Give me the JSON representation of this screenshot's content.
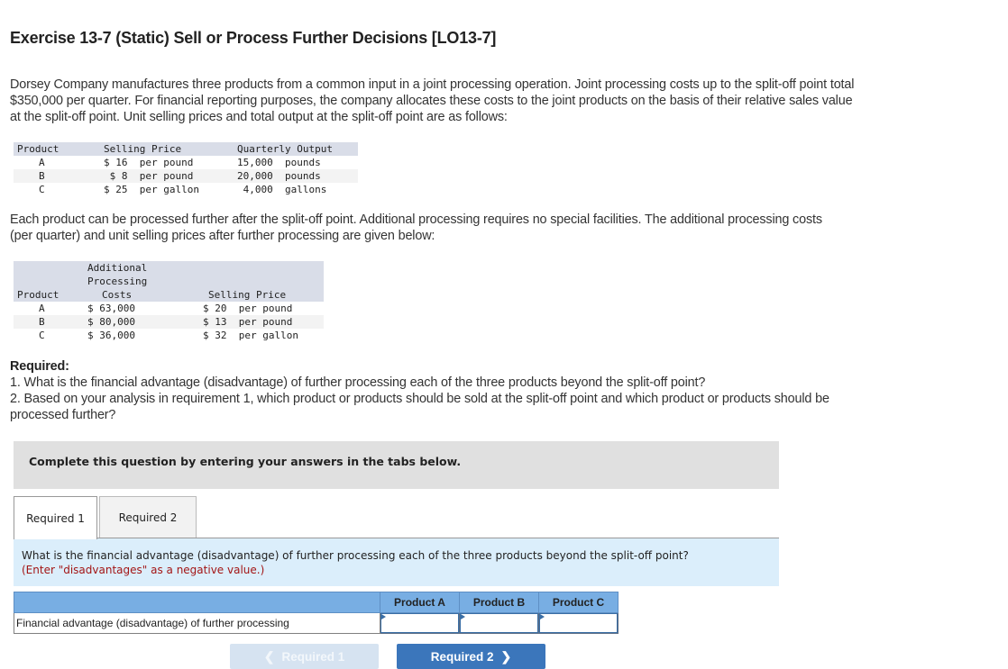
{
  "title": "Exercise 13-7 (Static) Sell or Process Further Decisions [LO13-7]",
  "intro": "Dorsey Company manufactures three products from a common input in a joint processing operation. Joint processing costs up to the split-off point total $350,000 per quarter. For financial reporting purposes, the company allocates these costs to the joint products on the basis of their relative sales value at the split-off point. Unit selling prices and total output at the split-off point are as follows:",
  "table1": {
    "headers": [
      "Product",
      "Selling Price",
      "Quarterly Output"
    ],
    "rows": [
      {
        "product": "A",
        "price": "$ 16  per pound",
        "output": "15,000  pounds"
      },
      {
        "product": "B",
        "price": " $ 8  per pound",
        "output": "20,000  pounds"
      },
      {
        "product": "C",
        "price": "$ 25  per gallon",
        "output": " 4,000  gallons"
      }
    ]
  },
  "para2": "Each product can be processed further after the split-off point. Additional processing requires no special facilities. The additional processing costs (per quarter) and unit selling prices after further processing are given below:",
  "table2": {
    "headers": {
      "product": "Product",
      "costs_line1": "Additional",
      "costs_line2": "Processing",
      "costs_line3": "Costs",
      "price": "Selling Price"
    },
    "rows": [
      {
        "product": "A",
        "costs": "$ 63,000",
        "price": "$ 20  per pound"
      },
      {
        "product": "B",
        "costs": "$ 80,000",
        "price": "$ 13  per pound"
      },
      {
        "product": "C",
        "costs": "$ 36,000",
        "price": "$ 32  per gallon"
      }
    ]
  },
  "required": {
    "heading": "Required:",
    "items": [
      "1. What is the financial advantage (disadvantage) of further processing each of the three products beyond the split-off point?",
      "2. Based on your analysis in requirement 1, which product or products should be sold at the split-off point and which product or products should be processed further?"
    ]
  },
  "banner": "Complete this question by entering your answers in the tabs below.",
  "tabs": [
    {
      "label": "Required 1",
      "active": true
    },
    {
      "label": "Required 2",
      "active": false
    }
  ],
  "question": {
    "text": "What is the financial advantage (disadvantage) of further processing each of the three products beyond the split-off point?",
    "hint": "(Enter \"disadvantages\" as a negative value.)"
  },
  "answer_table": {
    "columns": [
      "Product A",
      "Product B",
      "Product C"
    ],
    "row_label": "Financial advantage (disadvantage) of further processing",
    "values": [
      "",
      "",
      ""
    ]
  },
  "nav": {
    "prev_label": "Required 1",
    "next_label": "Required 2",
    "prev_icon": "chevron-left-icon",
    "next_icon": "chevron-right-icon"
  },
  "colors": {
    "header_blue": "#78aee3",
    "question_bg": "#dbeefb",
    "hint_red": "#a31515",
    "next_button": "#3b76bb",
    "prev_button_disabled": "#d6e3f1"
  }
}
